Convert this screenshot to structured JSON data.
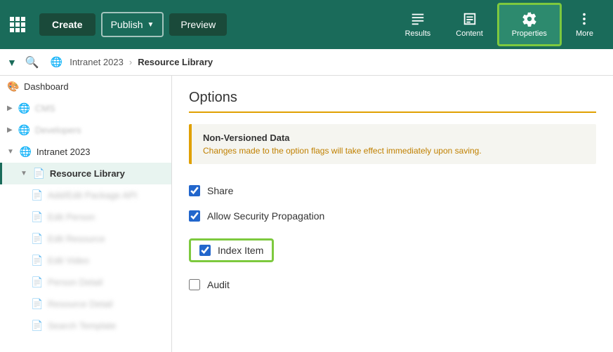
{
  "toolbar": {
    "create_label": "Create",
    "publish_label": "Publish",
    "preview_label": "Preview",
    "results_label": "Results",
    "content_label": "Content",
    "properties_label": "Properties",
    "more_label": "More"
  },
  "breadcrumb": {
    "toggle": "▼",
    "parent": "Intranet 2023",
    "separator": "›",
    "current": "Resource Library"
  },
  "sidebar": {
    "items": [
      {
        "id": "dashboard",
        "label": "Dashboard",
        "icon": "🎨",
        "level": 0
      },
      {
        "id": "item2",
        "label": "CMS",
        "icon": "🌐",
        "level": 0,
        "blurred": true
      },
      {
        "id": "item3",
        "label": "Developers",
        "icon": "🌐",
        "level": 0,
        "blurred": true
      },
      {
        "id": "intranet",
        "label": "Intranet 2023",
        "icon": "🌐",
        "level": 0
      },
      {
        "id": "resource-library",
        "label": "Resource Library",
        "icon": "📄",
        "level": 1,
        "active": true
      },
      {
        "id": "child1",
        "label": "Add/Edit Package API",
        "icon": "📄",
        "level": 2,
        "blurred": true
      },
      {
        "id": "child2",
        "label": "Edit Person",
        "icon": "📄",
        "level": 2,
        "blurred": true
      },
      {
        "id": "child3",
        "label": "Edit Resource",
        "icon": "📄",
        "level": 2,
        "blurred": true
      },
      {
        "id": "child4",
        "label": "Edit Video",
        "icon": "📄",
        "level": 2,
        "blurred": true
      },
      {
        "id": "child5",
        "label": "Person Detail",
        "icon": "📄",
        "level": 2,
        "blurred": true
      },
      {
        "id": "child6",
        "label": "Resource Detail",
        "icon": "📄",
        "level": 2,
        "blurred": true
      },
      {
        "id": "child7",
        "label": "Search Template",
        "icon": "📄",
        "level": 2,
        "blurred": true
      }
    ]
  },
  "main": {
    "section_title": "Options",
    "info_box": {
      "title": "Non-Versioned Data",
      "text": "Changes made to the option flags will take effect immediately upon saving."
    },
    "checkboxes": [
      {
        "id": "share",
        "label": "Share",
        "checked": true,
        "highlighted": false
      },
      {
        "id": "allow-security",
        "label": "Allow Security Propagation",
        "checked": true,
        "highlighted": false
      },
      {
        "id": "index-item",
        "label": "Index Item",
        "checked": true,
        "highlighted": true
      },
      {
        "id": "audit",
        "label": "Audit",
        "checked": false,
        "highlighted": false
      }
    ]
  }
}
